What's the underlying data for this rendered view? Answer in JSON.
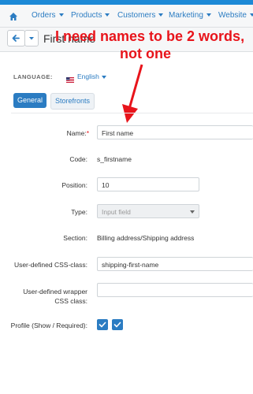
{
  "nav": {
    "home_icon": "home-icon",
    "items": [
      {
        "label": "Orders"
      },
      {
        "label": "Products"
      },
      {
        "label": "Customers"
      },
      {
        "label": "Marketing"
      },
      {
        "label": "Website"
      }
    ]
  },
  "toolbar": {
    "back_icon": "arrow-left-icon",
    "dropdown_icon": "caret-down-icon",
    "title": "First name"
  },
  "annotation": {
    "line1": "I need names to be 2 words,",
    "line2": "not one",
    "color": "#e8141b"
  },
  "language": {
    "label": "LANGUAGE:",
    "value": "English",
    "flag_icon": "us-flag-icon"
  },
  "tabs": [
    {
      "label": "General",
      "active": true
    },
    {
      "label": "Storefronts",
      "active": false
    }
  ],
  "form": {
    "name_label": "Name:",
    "name_required": "*",
    "name_value": "First name",
    "code_label": "Code:",
    "code_value": "s_firstname",
    "position_label": "Position:",
    "position_value": "10",
    "type_label": "Type:",
    "type_value": "Input field",
    "section_label": "Section:",
    "section_value": "Billing address/Shipping address",
    "css_label": "User-defined CSS-class:",
    "css_value": "shipping-first-name",
    "wrapper_label_1": "User-defined wrapper",
    "wrapper_label_2": "CSS class:",
    "wrapper_value": "",
    "profile_label": "Profile (Show / Required):",
    "profile_show": true,
    "profile_required": true
  },
  "colors": {
    "accent": "#2b7cc2",
    "topbar": "#1c89d6",
    "annotation": "#e8141b"
  }
}
